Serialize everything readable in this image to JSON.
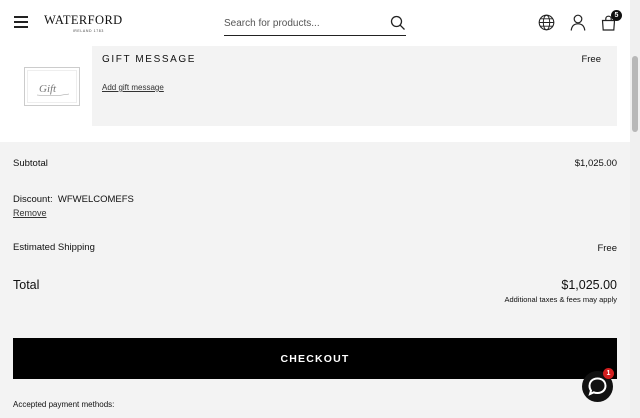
{
  "header": {
    "logo_main": "WATERFORD",
    "logo_sub": "IRELAND 1783",
    "search_placeholder": "Search for products...",
    "cart_count": "5"
  },
  "gift": {
    "title": "GIFT MESSAGE",
    "price": "Free",
    "link": "Add gift message",
    "thumb_text": "Gift"
  },
  "summary": {
    "subtotal_label": "Subtotal",
    "subtotal_value": "$1,025.00",
    "discount_label": "Discount:",
    "discount_code": "WFWELCOMEFS",
    "remove_label": "Remove",
    "shipping_label": "Estimated Shipping",
    "shipping_value": "Free",
    "total_label": "Total",
    "total_value": "$1,025.00",
    "tax_note": "Additional taxes & fees may apply"
  },
  "checkout": {
    "label": "CHECKOUT"
  },
  "payment": {
    "label": "Accepted payment methods:"
  },
  "chat": {
    "badge": "1"
  }
}
